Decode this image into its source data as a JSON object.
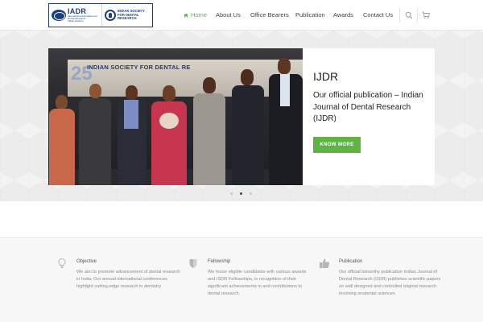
{
  "logo": {
    "left_acronym": "IADR",
    "left_caption": "International Association for Dental Research",
    "left_sub": "Indian Division",
    "right_caption": "INDIAN SOCIETY FOR DENTAL RESEARCH"
  },
  "nav": {
    "items": [
      {
        "label": "Home",
        "active": true
      },
      {
        "label": "About Us"
      },
      {
        "label": "Office Bearers"
      },
      {
        "label": "Publication"
      },
      {
        "label": "Awards"
      },
      {
        "label": "Contact Us"
      }
    ],
    "icons": [
      "search-icon",
      "cart-icon"
    ]
  },
  "slider": {
    "banner_text": "INDIAN SOCIETY FOR DENTAL RE",
    "banner_num": "25",
    "title": "IJDR",
    "text": "Our official publication – Indian Journal of Dental Research (IJDR)",
    "button": "KNOW MORE",
    "dots": 3,
    "active_dot": 1
  },
  "features": [
    {
      "icon": "lightbulb-icon",
      "title": "Objective",
      "text": "We aim to promote advancement of dental research in India. Our annual international conferences highlight cutting-edge research in dentistry"
    },
    {
      "icon": "shield-icon",
      "title": "Fellowship",
      "text": "We honor eligible candidates with various awards and ISDR Fellowships, in recognition of their significant achievements in and contributions to dental research."
    },
    {
      "icon": "thumbs-up-icon",
      "title": "Publication",
      "text": "Our official bimonthy publication Indian Journal of Dental Research (IJDR) publishes scientific papers on well designed and controlled original research involving orodental sciences"
    }
  ],
  "colors": {
    "accent": "#5fb244",
    "brand": "#1c3f7a"
  }
}
